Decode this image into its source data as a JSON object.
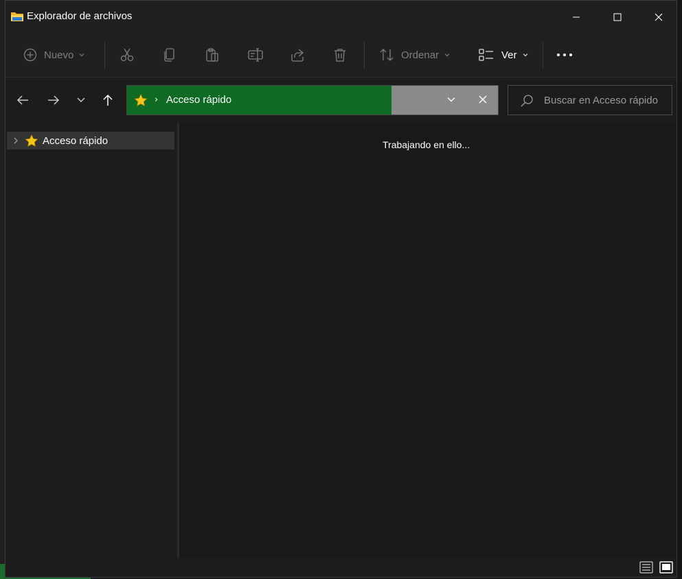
{
  "window": {
    "title": "Explorador de archivos"
  },
  "toolbar": {
    "new_label": "Nuevo",
    "sort_label": "Ordenar",
    "view_label": "Ver"
  },
  "address": {
    "location": "Acceso rápido"
  },
  "search": {
    "placeholder": "Buscar en Acceso rápido"
  },
  "navpane": {
    "items": [
      {
        "label": "Acceso rápido",
        "icon": "star-icon"
      }
    ]
  },
  "content": {
    "status": "Trabajando en ello..."
  },
  "colors": {
    "address_progress": "#0f6a23",
    "star": "#f5c518",
    "background": "#1c1c1c"
  }
}
